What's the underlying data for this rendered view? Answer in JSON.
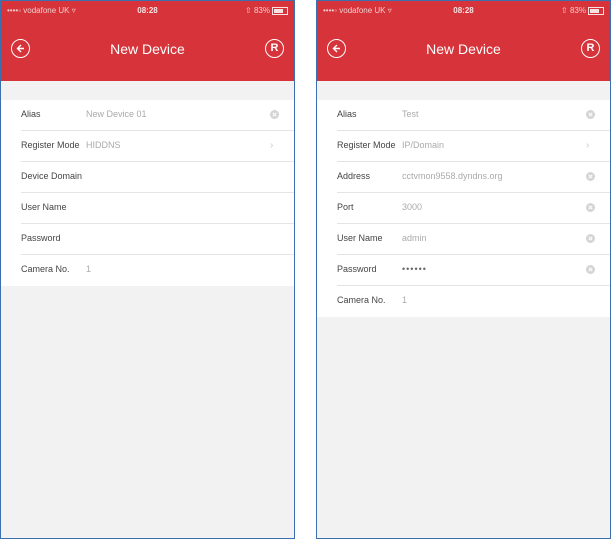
{
  "screens": [
    {
      "status": {
        "carrier": "••••◦ vodafone UK ▿",
        "time": "08:28",
        "battery": "83%"
      },
      "header": {
        "title": "New Device",
        "back_icon": "back-circle-icon",
        "action_icon": "registered-circle-icon"
      },
      "fields": [
        {
          "label": "Alias",
          "value": "New Device 01",
          "accessory": "clear"
        },
        {
          "label": "Register Mode",
          "value": "HIDDNS",
          "accessory": "chevron"
        },
        {
          "label": "Device Domain",
          "value": "",
          "accessory": "none"
        },
        {
          "label": "User Name",
          "value": "",
          "accessory": "none"
        },
        {
          "label": "Password",
          "value": "",
          "accessory": "none"
        },
        {
          "label": "Camera No.",
          "value": "1",
          "accessory": "none"
        }
      ]
    },
    {
      "status": {
        "carrier": "••••◦ vodafone UK ▿",
        "time": "08:28",
        "battery": "83%"
      },
      "header": {
        "title": "New Device",
        "back_icon": "back-circle-icon",
        "action_icon": "registered-circle-icon"
      },
      "fields": [
        {
          "label": "Alias",
          "value": "Test",
          "accessory": "clear"
        },
        {
          "label": "Register Mode",
          "value": "IP/Domain",
          "accessory": "chevron"
        },
        {
          "label": "Address",
          "value": "cctvmon9558.dyndns.org",
          "accessory": "clear"
        },
        {
          "label": "Port",
          "value": "3000",
          "accessory": "clear"
        },
        {
          "label": "User Name",
          "value": "admin",
          "accessory": "clear"
        },
        {
          "label": "Password",
          "value": "••••••",
          "accessory": "clear"
        },
        {
          "label": "Camera No.",
          "value": "1",
          "accessory": "none"
        }
      ]
    }
  ],
  "colors": {
    "header": "#d6343a",
    "frame": "#3a6fb0",
    "background": "#f2f2f2"
  }
}
